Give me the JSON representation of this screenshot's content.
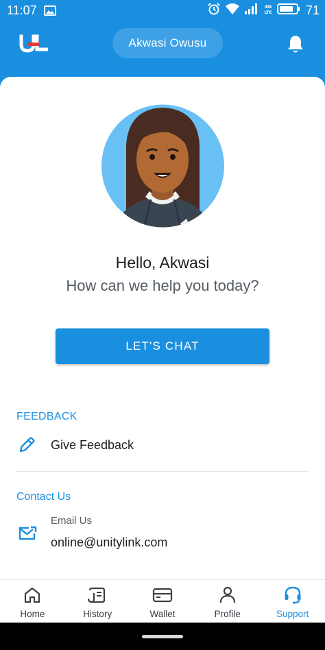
{
  "status_bar": {
    "time": "11:07",
    "network_label": "4G LTE",
    "battery_level": "71"
  },
  "header": {
    "logo_text": "UL",
    "user_name": "Akwasi Owusu"
  },
  "main": {
    "greeting": "Hello, Akwasi",
    "subtitle": "How can we help you today?",
    "chat_button_label": "LET'S CHAT"
  },
  "feedback": {
    "section_title": "FEEDBACK",
    "item_label": "Give Feedback"
  },
  "contact": {
    "section_title": "Contact Us",
    "email_label": "Email Us",
    "email_address": "online@unitylink.com"
  },
  "bottom_nav": {
    "items": [
      {
        "label": "Home",
        "icon": "home-icon",
        "active": false
      },
      {
        "label": "History",
        "icon": "history-icon",
        "active": false
      },
      {
        "label": "Wallet",
        "icon": "wallet-icon",
        "active": false
      },
      {
        "label": "Profile",
        "icon": "profile-icon",
        "active": false
      },
      {
        "label": "Support",
        "icon": "support-headset-icon",
        "active": true
      }
    ]
  },
  "colors": {
    "accent": "#1a8fe0",
    "text_primary": "#1e1e1e",
    "text_secondary": "#555c63",
    "background": "#ffffff"
  }
}
